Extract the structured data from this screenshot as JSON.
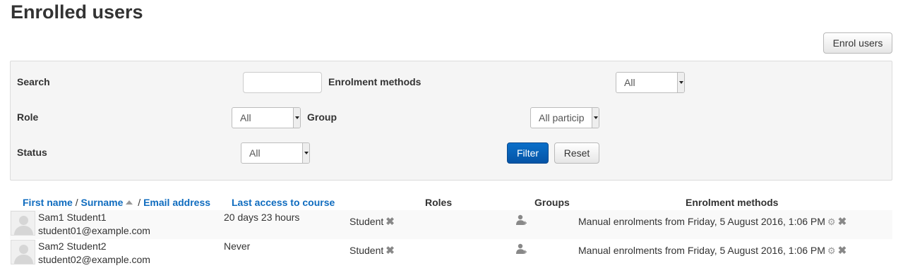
{
  "page": {
    "title": "Enrolled users"
  },
  "toolbar": {
    "enrol_label": "Enrol users"
  },
  "filters": {
    "search_label": "Search",
    "search_value": "",
    "enrolment_methods_label": "Enrolment methods",
    "enrolment_methods_value": "All",
    "role_label": "Role",
    "role_value": "All",
    "group_label": "Group",
    "group_value": "All particip",
    "status_label": "Status",
    "status_value": "All",
    "filter_label": "Filter",
    "reset_label": "Reset"
  },
  "table": {
    "headers": {
      "first_name": "First name",
      "sep1": " / ",
      "surname": "Surname",
      "sep2": " / ",
      "email": "Email address",
      "last_access": "Last access to course",
      "roles": "Roles",
      "groups": "Groups",
      "enrolment_methods": "Enrolment methods"
    },
    "rows": [
      {
        "name": "Sam1 Student1",
        "email": "student01@example.com",
        "last_access": "20 days 23 hours",
        "role": "Student",
        "enrolment": "Manual enrolments from Friday, 5 August 2016, 1:06 PM"
      },
      {
        "name": "Sam2 Student2",
        "email": "student02@example.com",
        "last_access": "Never",
        "role": "Student",
        "enrolment": "Manual enrolments from Friday, 5 August 2016, 1:06 PM"
      }
    ]
  },
  "icons": {
    "unenrol": "close-icon",
    "edit_enrolment": "gear-icon",
    "add_group": "add-user-group-icon"
  }
}
